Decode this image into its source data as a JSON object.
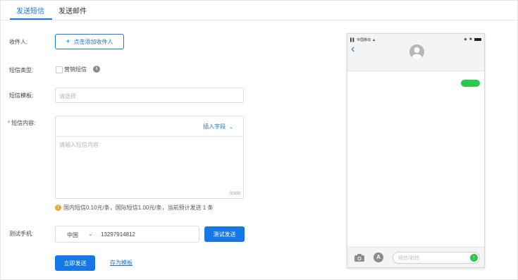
{
  "tabs": [
    {
      "label": "发送短信",
      "active": true
    },
    {
      "label": "发送邮件",
      "active": false
    }
  ],
  "form": {
    "recipient_label": "收件人:",
    "add_recipient_button": "点击添加收件人",
    "sms_type_label": "短信类型:",
    "marketing_checkbox": {
      "label": "营销短信",
      "checked": false
    },
    "template_label": "短信模板:",
    "template_placeholder": "请选择",
    "content_label": "短信内容:",
    "insert_field_label": "插入字段",
    "content_placeholder": "请输入短信内容",
    "char_counter": "0/300",
    "notice": "国内短信0.10元/条，国际短信1.00元/条，当前预计发送 1 条",
    "test_phone_label": "测试手机:",
    "country": "中国",
    "phone_number": "13297914812",
    "test_send_button": "测试发送",
    "send_now_button": "立即发送",
    "save_template_link": "存为模板"
  },
  "preview": {
    "carrier": "中国移动",
    "message_input_placeholder": "短信/彩信"
  },
  "colors": {
    "primary": "#1877e6",
    "bubble_green": "#2bc84c",
    "warning": "#f5a623",
    "required": "#f04a4a"
  }
}
